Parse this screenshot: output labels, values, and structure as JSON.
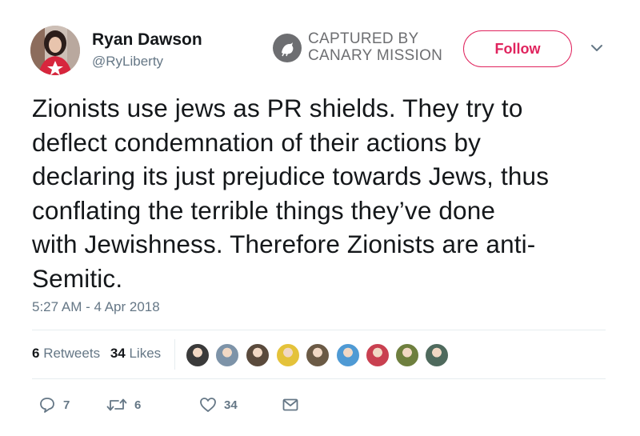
{
  "author": {
    "name": "Ryan Dawson",
    "handle": "@RyLiberty"
  },
  "watermark": {
    "line1": "CAPTURED BY",
    "line2": "CANARY MISSION"
  },
  "follow_label": "Follow",
  "tweet_lines": [
    "Zionists use jews as PR shields. They try to",
    "deflect condemnation of their actions by",
    "declaring its just prejudice towards Jews, thus",
    "conflating the terrible things they’ve done",
    "with Jewishness. Therefore Zionists are anti-",
    "Semitic."
  ],
  "timestamp": "5:27 AM - 4 Apr 2018",
  "stats": {
    "retweets_count": "6",
    "retweets_label": "Retweets",
    "likes_count": "34",
    "likes_label": "Likes"
  },
  "liker_avatar_colors": [
    "#3a3a3a",
    "#7d93a8",
    "#5a4a3c",
    "#e4c23a",
    "#6b5a45",
    "#4f9ad4",
    "#c94050",
    "#6e7f3e",
    "#4f6a5d"
  ],
  "actions": {
    "reply_count": "7",
    "retweet_count": "6",
    "like_count": "34"
  },
  "icons": {
    "reply": "reply-icon",
    "retweet": "retweet-icon",
    "like": "heart-icon",
    "dm": "envelope-icon",
    "more": "chevron-down-icon"
  },
  "colors": {
    "follow_accent": "#e0245e",
    "secondary_text": "#657786",
    "watermark_gray": "#6d6e71"
  }
}
